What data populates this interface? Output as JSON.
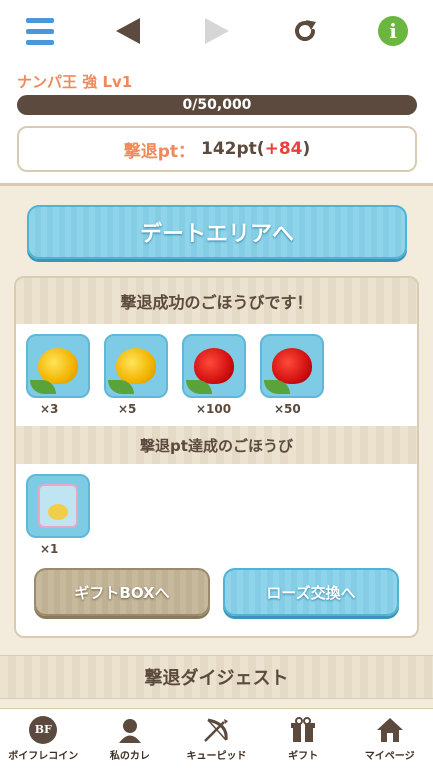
{
  "nav": {
    "menu_icon": "hamburger-icon",
    "back_icon": "triangle-left-icon",
    "forward_icon": "triangle-right-icon",
    "reload_icon": "reload-icon",
    "info_icon": "info-icon",
    "info_glyph": "i"
  },
  "status": {
    "enemy_name": "ナンパ王 強 Lv1",
    "hp_text": "0/50,000",
    "pt_label": "撃退pt：",
    "pt_value": "142pt",
    "pt_open": " (",
    "pt_plus": "+84",
    "pt_close": ")"
  },
  "date_button": "デートエリアへ",
  "rewards": {
    "header": "撃退成功のごほうびです！",
    "items": [
      {
        "icon": "yellow-rose-icon",
        "count": "×3"
      },
      {
        "icon": "yellow-rose-icon",
        "count": "×5"
      },
      {
        "icon": "red-rose-icon",
        "count": "×100"
      },
      {
        "icon": "red-rose-icon",
        "count": "×50"
      }
    ],
    "pt_header": "撃退pt達成のごほうび",
    "pt_items": [
      {
        "icon": "gift-item-icon",
        "count": "×1"
      }
    ],
    "gift_box_button": "ギフトBOXへ",
    "rose_exchange_button": "ローズ交換へ"
  },
  "digest_header": "撃退ダイジェスト",
  "tabs": [
    {
      "icon": "bf-coin-icon",
      "glyph": "BF",
      "label": "ボイフレコイン"
    },
    {
      "icon": "boyfriend-icon",
      "label": "私のカレ"
    },
    {
      "icon": "cupid-bow-icon",
      "label": "キューピッド"
    },
    {
      "icon": "gift-box-icon",
      "label": "ギフト"
    },
    {
      "icon": "house-icon",
      "label": "マイページ"
    }
  ],
  "colors": {
    "accent_blue": "#4a98d9",
    "brown": "#5b4a3d",
    "orange_label": "#f08a5d",
    "plus_red": "#e8423a",
    "info_green": "#6ab63e"
  }
}
